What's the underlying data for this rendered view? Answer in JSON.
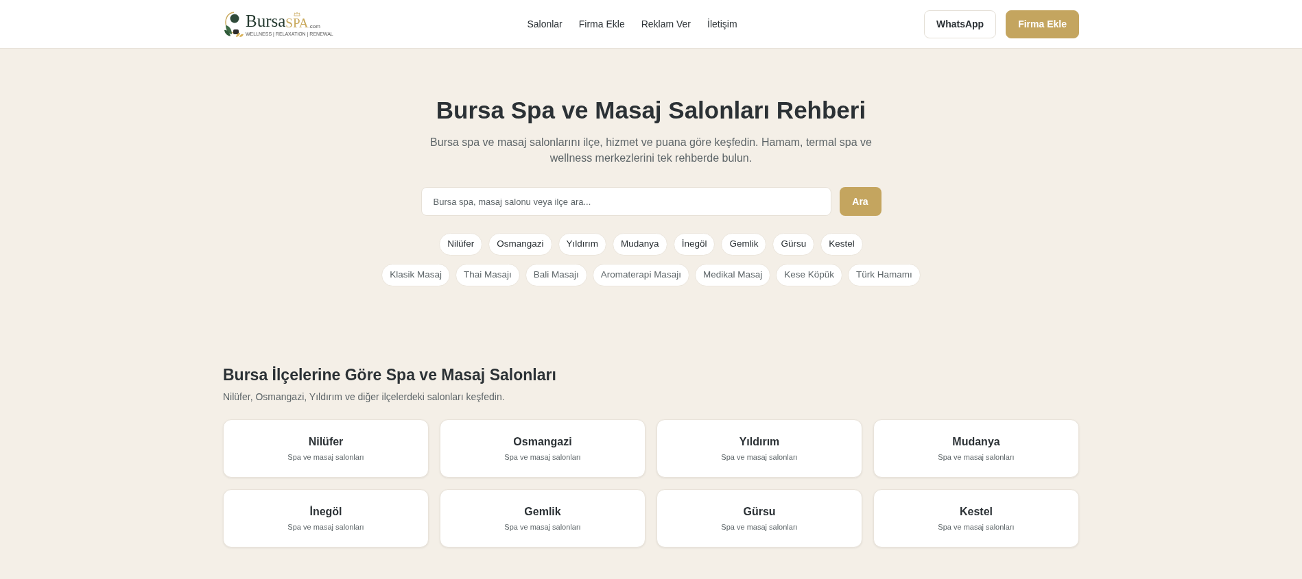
{
  "header": {
    "logo": {
      "word": "Bursa",
      "accent": "SPA",
      "suffix": ".com",
      "tagline": "WELLNESS | RELAXATION | RENEWAL"
    },
    "nav": [
      {
        "label": "Salonlar"
      },
      {
        "label": "Firma Ekle"
      },
      {
        "label": "Reklam Ver"
      },
      {
        "label": "İletişim"
      }
    ],
    "buttons": [
      {
        "label": "WhatsApp",
        "kind": "outline"
      },
      {
        "label": "Firma Ekle",
        "kind": "primary"
      }
    ]
  },
  "hero": {
    "title": "Bursa Spa ve Masaj Salonları Rehberi",
    "subtitle": "Bursa spa ve masaj salonlarını ilçe, hizmet ve puana göre keşfedin. Hamam, termal spa ve wellness merkezlerini tek rehberde bulun.",
    "search": {
      "placeholder": "Bursa spa, masaj salonu veya ilçe ara...",
      "button": "Ara"
    },
    "district_chips": [
      "Nilüfer",
      "Osmangazi",
      "Yıldırım",
      "Mudanya",
      "İnegöl",
      "Gemlik",
      "Gürsu",
      "Kestel"
    ],
    "service_chips": [
      "Klasik Masaj",
      "Thai Masajı",
      "Bali Masajı",
      "Aromaterapi Masajı",
      "Medikal Masaj",
      "Kese Köpük",
      "Türk Hamamı"
    ]
  },
  "districts_section": {
    "title": "Bursa İlçelerine Göre Spa ve Masaj Salonları",
    "subtitle": "Nilüfer, Osmangazi, Yıldırım ve diğer ilçelerdeki salonları keşfedin.",
    "cards": [
      {
        "name": "Nilüfer",
        "caption": "Spa ve masaj salonları"
      },
      {
        "name": "Osmangazi",
        "caption": "Spa ve masaj salonları"
      },
      {
        "name": "Yıldırım",
        "caption": "Spa ve masaj salonları"
      },
      {
        "name": "Mudanya",
        "caption": "Spa ve masaj salonları"
      },
      {
        "name": "İnegöl",
        "caption": "Spa ve masaj salonları"
      },
      {
        "name": "Gemlik",
        "caption": "Spa ve masaj salonları"
      },
      {
        "name": "Gürsu",
        "caption": "Spa ve masaj salonları"
      },
      {
        "name": "Kestel",
        "caption": "Spa ve masaj salonları"
      }
    ]
  }
}
